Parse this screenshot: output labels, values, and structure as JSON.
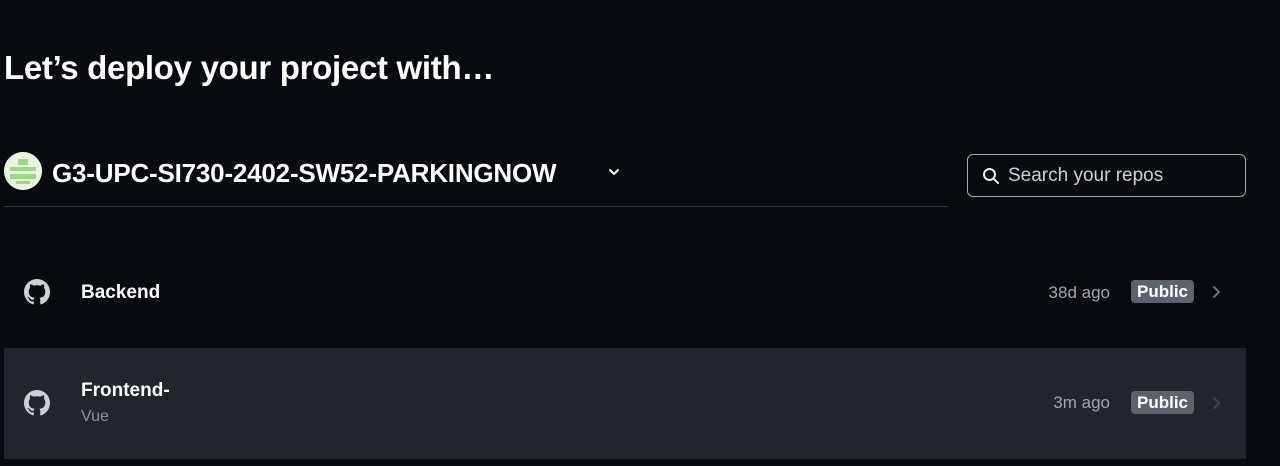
{
  "page": {
    "heading": "Let’s deploy your project with…"
  },
  "account": {
    "name": "G3-UPC-SI730-2402-SW52-PARKINGNOW",
    "avatar_icon": "identicon-avatar",
    "dropdown_icon": "chevron-down-icon"
  },
  "search": {
    "placeholder": "Search your repos",
    "value": "",
    "icon": "search-icon"
  },
  "repos": [
    {
      "name": "Backend",
      "framework": "",
      "updated": "38d ago",
      "visibility": "Public",
      "icon": "github-icon"
    },
    {
      "name": "Frontend-",
      "framework": "Vue",
      "updated": "3m ago",
      "visibility": "Public",
      "icon": "github-icon"
    }
  ],
  "colors": {
    "background": "#070b10",
    "row_highlight": "#21262d",
    "badge_background": "#5a636e",
    "muted_text": "#9ea7b3",
    "avatar_green": "#9ed683"
  }
}
